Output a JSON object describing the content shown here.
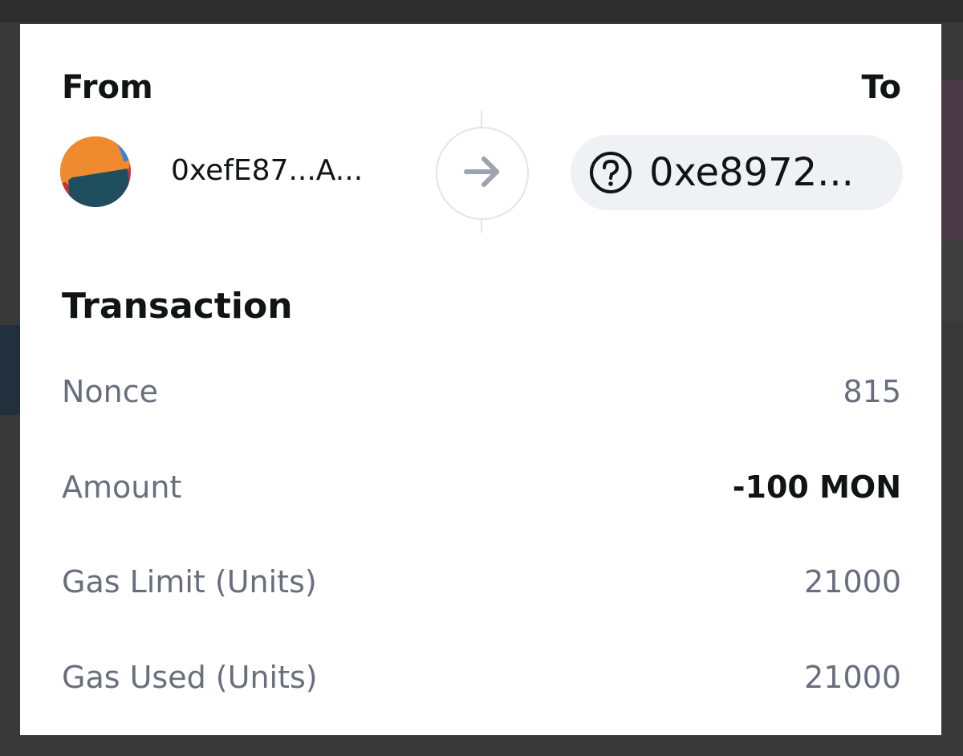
{
  "modal": {
    "from_label": "From",
    "to_label": "To",
    "from_address": "0xefE87...A...",
    "to_address": "0xe8972...",
    "section_title": "Transaction",
    "rows": [
      {
        "label": "Nonce",
        "value": "815"
      },
      {
        "label": "Amount",
        "value": "-100 MON"
      },
      {
        "label": "Gas Limit (Units)",
        "value": "21000"
      },
      {
        "label": "Gas Used (Units)",
        "value": "21000"
      }
    ]
  },
  "icons": {
    "arrow": "arrow-right-icon",
    "unknown_recipient": "question-circle-icon",
    "avatar": "account-avatar"
  },
  "colors": {
    "text_primary": "#121314",
    "text_muted": "#686e7d",
    "pill_background": "#eff1f4",
    "border": "#e2e4e9",
    "arrow": "#9ea3b0",
    "avatar_orange": "#f08a2e",
    "avatar_teal": "#1f4e5f",
    "avatar_red": "#c8323f",
    "avatar_blue": "#3b82d6"
  }
}
